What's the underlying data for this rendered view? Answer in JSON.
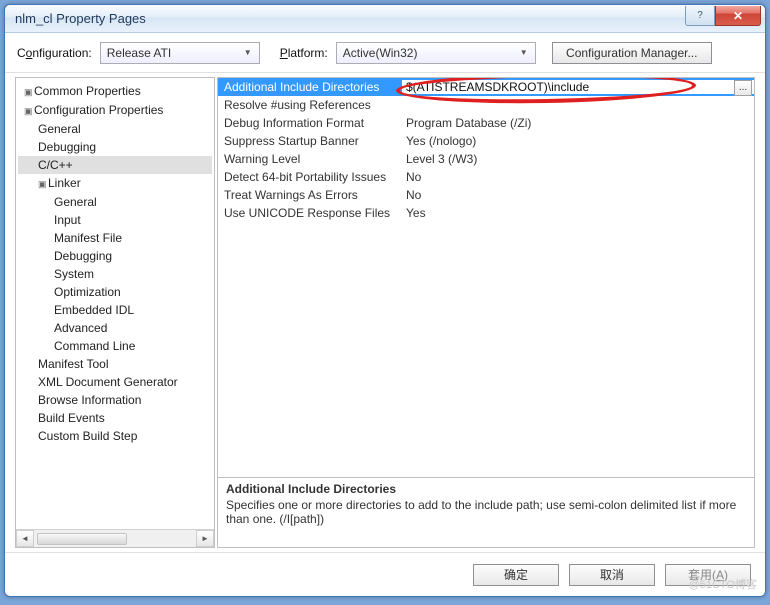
{
  "window": {
    "title": "nlm_cl Property Pages"
  },
  "toolbar": {
    "config_label": "Configuration:",
    "config_value": "Release ATI",
    "platform_label": "Platform:",
    "platform_value": "Active(Win32)",
    "config_manager": "Configuration Manager..."
  },
  "tree": {
    "nodes": [
      {
        "label": "Common Properties",
        "level": 0,
        "expandable": true
      },
      {
        "label": "Configuration Properties",
        "level": 0,
        "expandable": true
      },
      {
        "label": "General",
        "level": 1
      },
      {
        "label": "Debugging",
        "level": 1
      },
      {
        "label": "C/C++",
        "level": 1,
        "selected": true
      },
      {
        "label": "Linker",
        "level": 1,
        "expandable": true
      },
      {
        "label": "General",
        "level": 2
      },
      {
        "label": "Input",
        "level": 2
      },
      {
        "label": "Manifest File",
        "level": 2
      },
      {
        "label": "Debugging",
        "level": 2
      },
      {
        "label": "System",
        "level": 2
      },
      {
        "label": "Optimization",
        "level": 2
      },
      {
        "label": "Embedded IDL",
        "level": 2
      },
      {
        "label": "Advanced",
        "level": 2
      },
      {
        "label": "Command Line",
        "level": 2
      },
      {
        "label": "Manifest Tool",
        "level": 1
      },
      {
        "label": "XML Document Generator",
        "level": 1
      },
      {
        "label": "Browse Information",
        "level": 1
      },
      {
        "label": "Build Events",
        "level": 1
      },
      {
        "label": "Custom Build Step",
        "level": 1
      }
    ]
  },
  "grid": {
    "rows": [
      {
        "label": "Additional Include Directories",
        "value": "$(ATISTREAMSDKROOT)\\include",
        "selected": true
      },
      {
        "label": "Resolve #using References",
        "value": ""
      },
      {
        "label": "Debug Information Format",
        "value": "Program Database (/Zi)"
      },
      {
        "label": "Suppress Startup Banner",
        "value": "Yes (/nologo)"
      },
      {
        "label": "Warning Level",
        "value": "Level 3 (/W3)"
      },
      {
        "label": "Detect 64-bit Portability Issues",
        "value": "No"
      },
      {
        "label": "Treat Warnings As Errors",
        "value": "No"
      },
      {
        "label": "Use UNICODE Response Files",
        "value": "Yes"
      }
    ]
  },
  "description": {
    "title": "Additional Include Directories",
    "body": "Specifies one or more directories to add to the include path; use semi-colon delimited list if more than one.     (/I[path])"
  },
  "footer": {
    "ok": "确定",
    "cancel": "取消",
    "apply_prefix": "套用(",
    "apply_key": "A",
    "apply_suffix": ")"
  },
  "watermark": "@51CTO博客"
}
